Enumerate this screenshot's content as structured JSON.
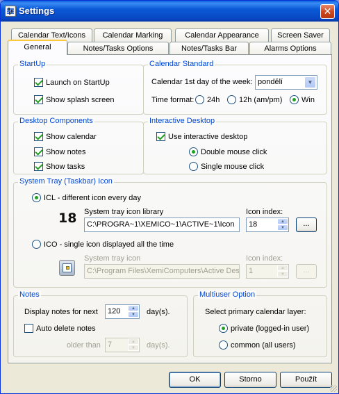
{
  "window": {
    "title": "Settings",
    "close": "✕"
  },
  "tabs_row1": [
    "Calendar Text/Icons",
    "Calendar Marking",
    "Calendar Appearance",
    "Screen Saver"
  ],
  "tabs_row2": [
    "General",
    "Notes/Tasks Options",
    "Notes/Tasks Bar",
    "Alarms Options"
  ],
  "startup": {
    "title": "StartUp",
    "launch": {
      "label": "Launch on StartUp",
      "checked": true
    },
    "splash": {
      "label": "Show splash screen",
      "checked": true
    }
  },
  "calendar_standard": {
    "title": "Calendar Standard",
    "first_day_label": "Calendar 1st day of the week:",
    "first_day_value": "pondělí",
    "time_format_label": "Time format:",
    "options": [
      "24h",
      "12h (am/pm)",
      "Win"
    ],
    "selected": "Win"
  },
  "desktop_components": {
    "title": "Desktop Components",
    "calendar": "Show calendar",
    "notes": "Show notes",
    "tasks": "Show tasks"
  },
  "interactive_desktop": {
    "title": "Interactive Desktop",
    "use": "Use interactive desktop",
    "double": "Double mouse click",
    "single": "Single mouse click",
    "selected": "Double mouse click"
  },
  "system_tray": {
    "title": "System Tray (Taskbar) Icon",
    "icl_label": "ICL - different icon every day",
    "library_label": "System tray icon library",
    "library_value": "C:\\PROGRA~1\\XEMICO~1\\ACTIVE~1\\Icon",
    "icon_index_label": "Icon index:",
    "icon_index_value": "18",
    "browse": "...",
    "icl_number": "18",
    "ico_label": "ICO - single icon displayed all the time",
    "ico_file_label": "System tray icon",
    "ico_file_value": "C:\\Program Files\\XemiComputers\\Active Des",
    "ico_index_label": "Icon index:",
    "ico_index_value": "1",
    "ico_browse": "...",
    "selected": "ICL"
  },
  "notes": {
    "title": "Notes",
    "display_label": "Display notes for next",
    "display_value": "120",
    "days": "day(s).",
    "auto_delete": "Auto delete notes",
    "older_than": "older than",
    "older_value": "7",
    "older_days": "day(s)."
  },
  "multiuser": {
    "title": "Multiuser Option",
    "select_label": "Select primary calendar layer:",
    "private": "private (logged-in user)",
    "common": "common (all users)",
    "selected": "private"
  },
  "buttons": {
    "ok": "OK",
    "cancel": "Storno",
    "apply": "Použít"
  }
}
